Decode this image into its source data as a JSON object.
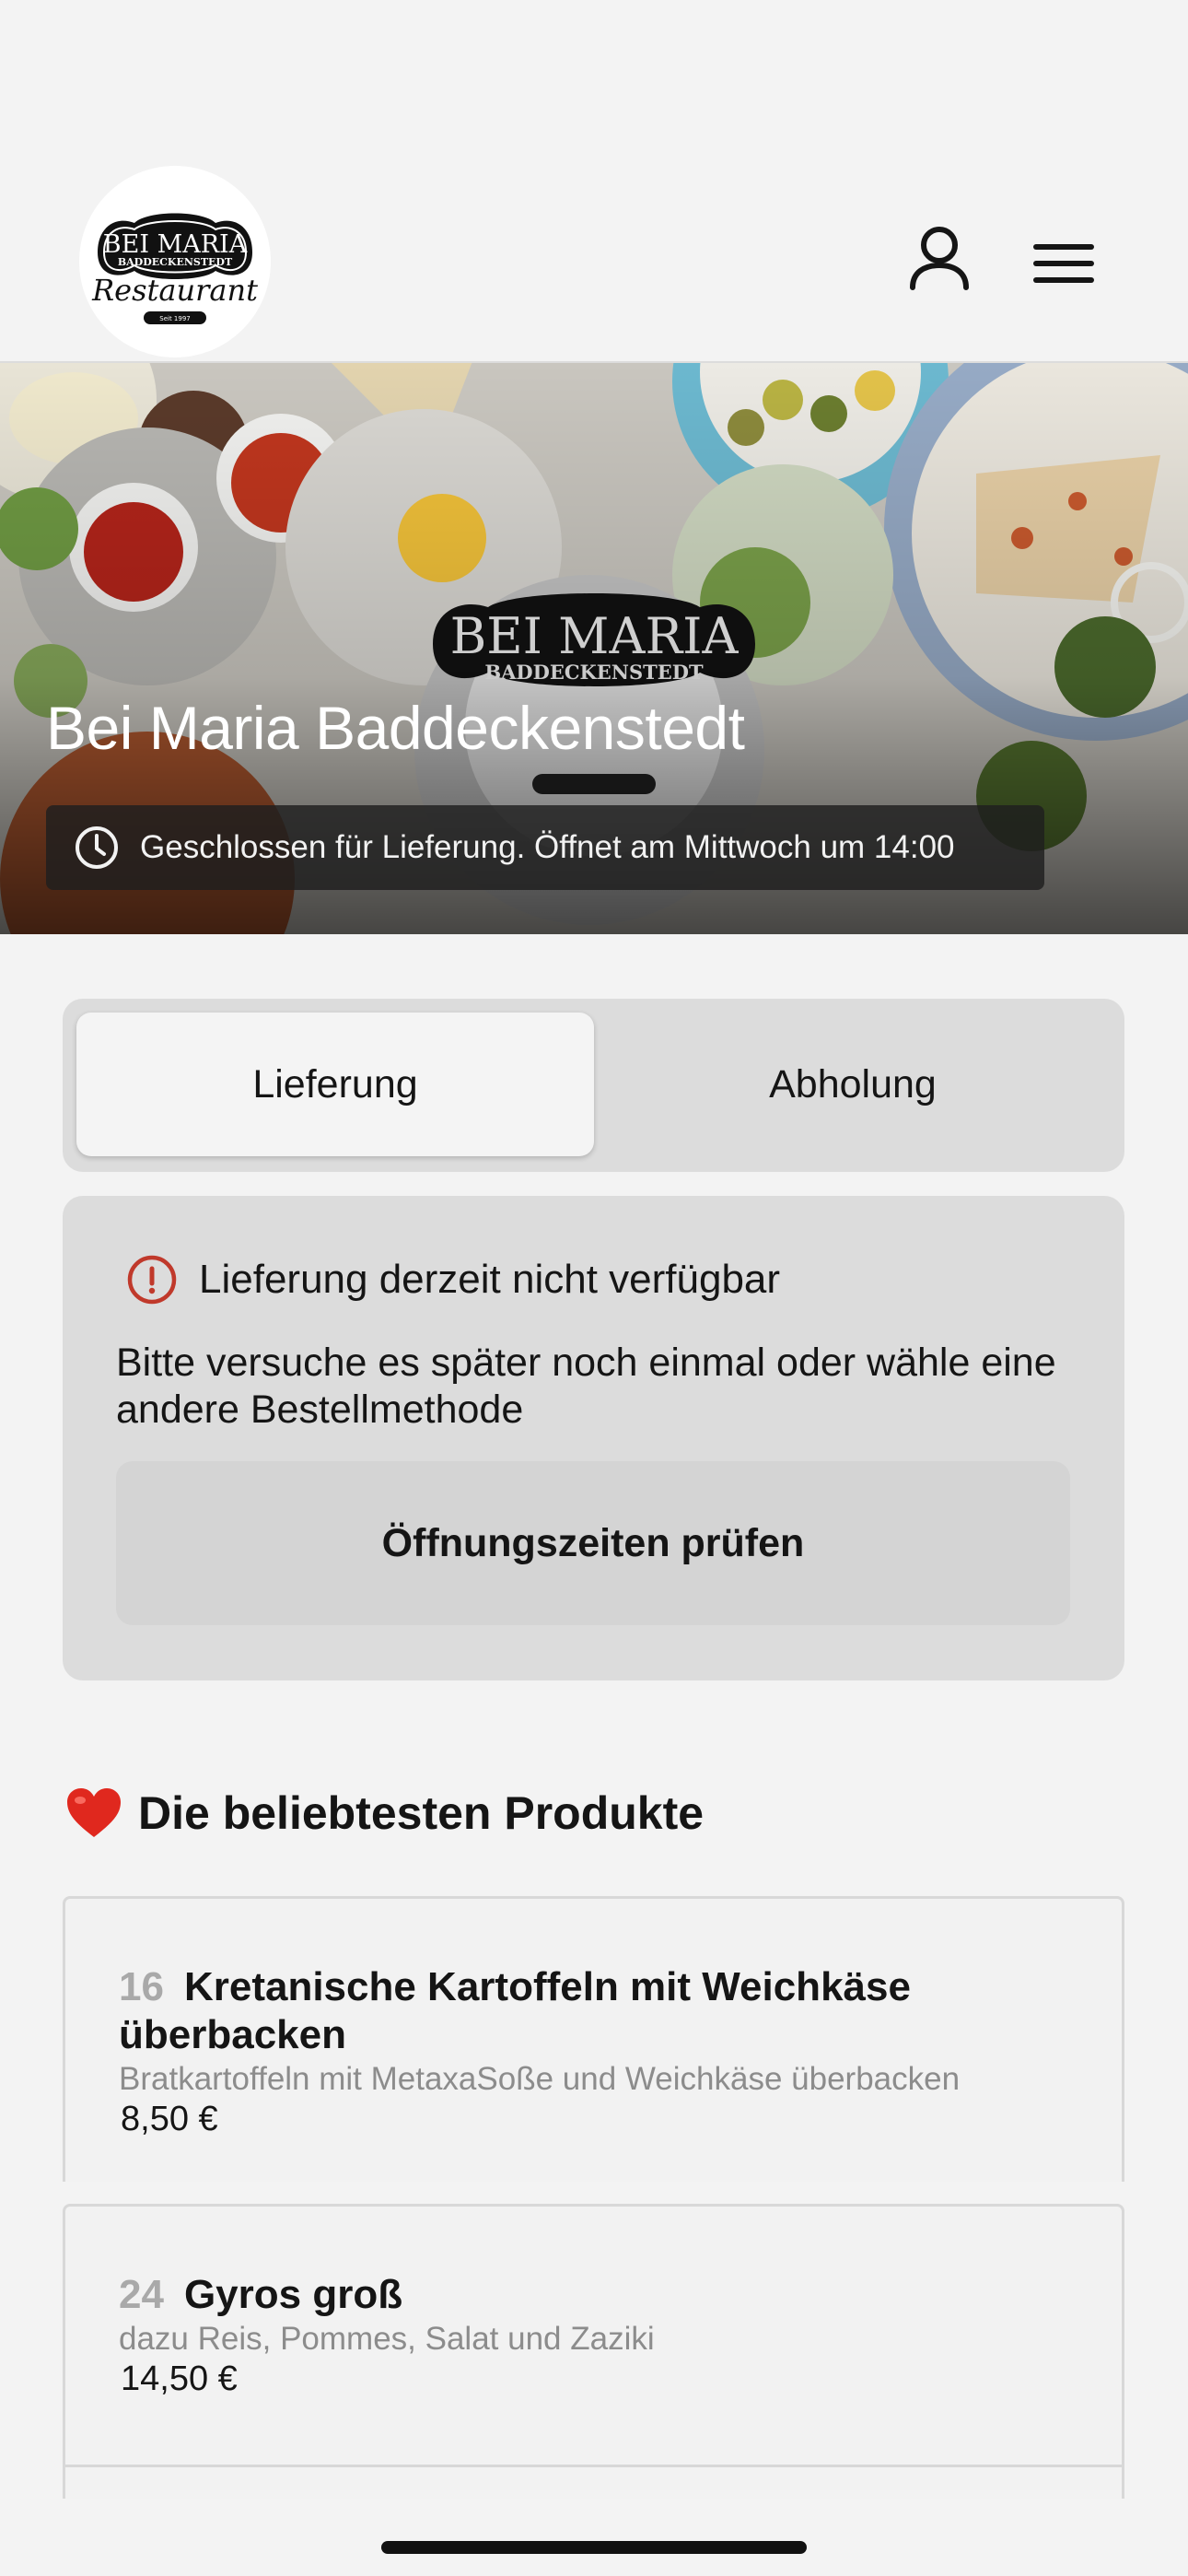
{
  "header": {
    "logo": {
      "name": "BEI MARIA",
      "sub": "BADDECKENSTEDT",
      "script": "Restaurant",
      "since": "Seit 1997"
    },
    "icons": {
      "account": "user-icon",
      "menu": "hamburger-menu-icon"
    }
  },
  "hero": {
    "title": "Bei Maria Baddeckenstedt",
    "status": "Geschlossen für Lieferung. Öffnet am Mittwoch um 14:00"
  },
  "order_mode": {
    "options": [
      "Lieferung",
      "Abholung"
    ],
    "selected": "Lieferung"
  },
  "notice": {
    "title": "Lieferung derzeit nicht verfügbar",
    "body": "Bitte versuche es später noch einmal oder wähle eine andere Bestellmethode",
    "button": "Öffnungszeiten prüfen",
    "icon_color": "#c0392b"
  },
  "popular": {
    "title": "Die beliebtesten Produkte",
    "items": [
      {
        "number": "16",
        "name": "Kretanische Kartoffeln mit Weichkäse überbacken",
        "description": "Bratkartoffeln mit MetaxaSoße und Weichkäse überbacken",
        "price": "8,50 €"
      },
      {
        "number": "24",
        "name": "Gyros groß",
        "description": "dazu Reis, Pommes, Salat und Zaziki",
        "price": "14,50 €"
      }
    ]
  }
}
